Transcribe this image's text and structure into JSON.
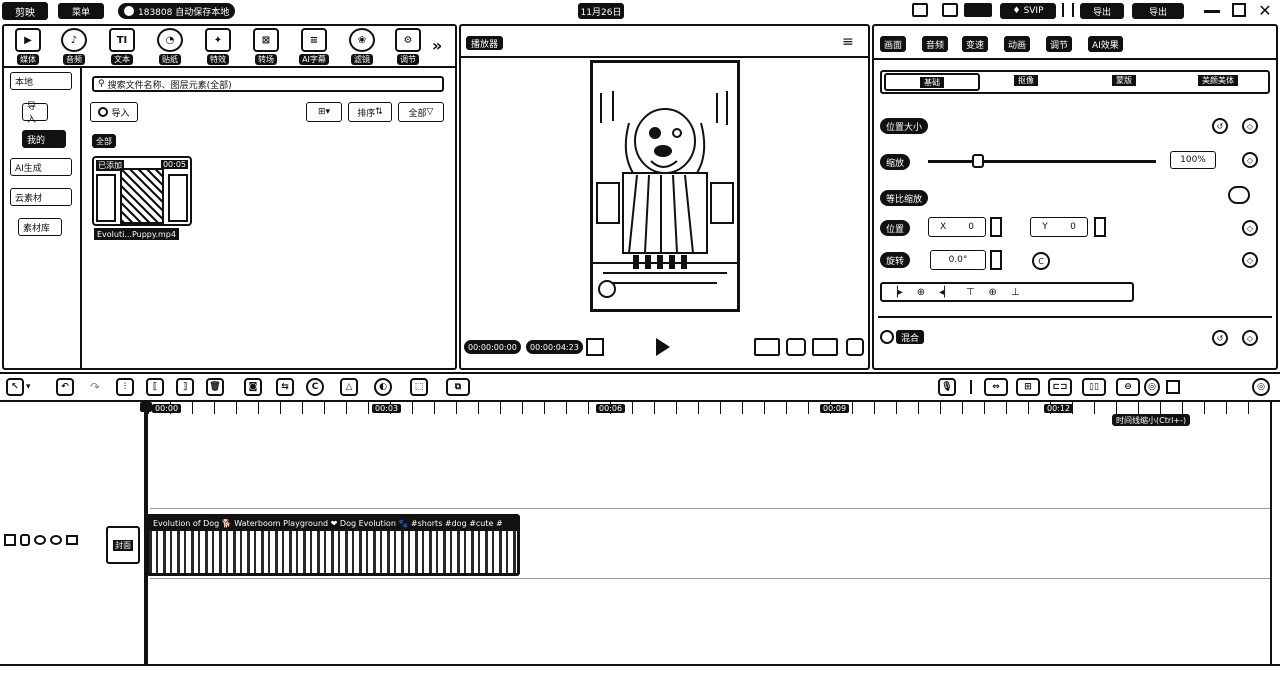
{
  "titlebar": {
    "app_name": "剪映",
    "menu_label": "菜单",
    "save_status": "183808 自动保存本地",
    "project_date": "11月26日",
    "vip_label": "SVIP",
    "export_label": "导出",
    "share_label": "导出"
  },
  "toolbar": {
    "items": [
      {
        "label": "媒体",
        "icon": "media-icon"
      },
      {
        "label": "音频",
        "icon": "audio-icon"
      },
      {
        "label": "文本",
        "icon": "text-icon",
        "glyph": "TI"
      },
      {
        "label": "贴纸",
        "icon": "sticker-icon"
      },
      {
        "label": "特效",
        "icon": "effects-icon"
      },
      {
        "label": "转场",
        "icon": "transition-icon"
      },
      {
        "label": "AI字幕",
        "icon": "ai-caption-icon"
      },
      {
        "label": "滤镜",
        "icon": "filter-icon"
      },
      {
        "label": "调节",
        "icon": "adjust-icon"
      }
    ]
  },
  "sidebar": {
    "items": [
      {
        "label": "本地"
      },
      {
        "label": "导入"
      },
      {
        "label": "我的"
      },
      {
        "label": "AI生成"
      },
      {
        "label": "云素材"
      },
      {
        "label": "素材库"
      }
    ]
  },
  "media": {
    "search_placeholder": "搜索文件名称、图层元素(全部)",
    "import_label": "导入",
    "sort_label": "排序",
    "filter_label": "全部",
    "all_label": "全部",
    "clip_badge": "已添加",
    "clip_duration": "00:05",
    "clip_name": "Evoluti...Puppy.mp4"
  },
  "player": {
    "title": "播放器",
    "current_time": "00:00:00:00",
    "total_time": "00:00:04:23"
  },
  "inspector": {
    "tabs": [
      "画面",
      "音频",
      "变速",
      "动画",
      "调节",
      "AI效果"
    ],
    "subtabs": [
      "基础",
      "抠像",
      "蒙版",
      "美颜美体"
    ],
    "position_size_label": "位置大小",
    "scale_label": "缩放",
    "scale_value": "100%",
    "uniform_scale_label": "等比缩放",
    "position_label": "位置",
    "pos_x_label": "X",
    "pos_x_value": "0",
    "pos_y_label": "Y",
    "pos_y_value": "0",
    "rotate_label": "旋转",
    "rotate_value": "0.0°",
    "blend_label": "混合"
  },
  "timeline": {
    "ruler": [
      "00:00",
      "00:03",
      "00:06",
      "00:09",
      "00:12"
    ],
    "tooltip": "时间线缩小(Ctrl+-)",
    "cover_label": "封面",
    "clip_title": "Evolution of Dog 🐕 Waterboom Playground ❤ Dog Evolution 🐾 #shorts #dog #cute #"
  }
}
